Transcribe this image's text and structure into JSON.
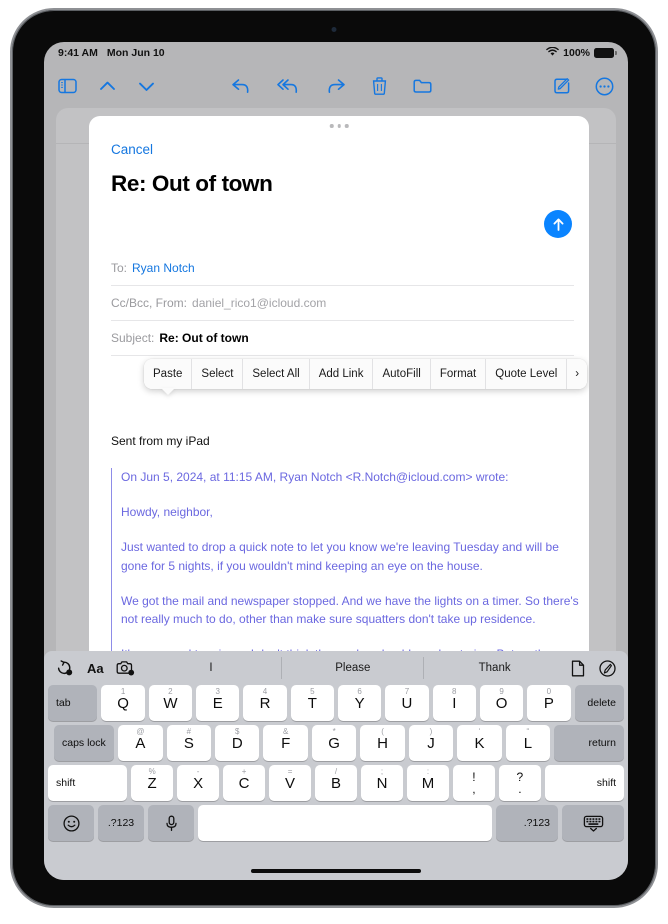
{
  "status_bar": {
    "time": "9:41 AM",
    "date": "Mon Jun 10",
    "battery_percent": "100%",
    "wifi_icon": "wifi-icon",
    "battery_icon": "battery-full-icon"
  },
  "mail_toolbar": {
    "sidebar_toggle": "sidebar-toggle-icon",
    "previous_message": "chevron-up-icon",
    "next_message": "chevron-down-icon",
    "reply": "reply-icon",
    "reply_all": "reply-all-icon",
    "forward": "forward-icon",
    "delete": "trash-icon",
    "move": "folder-icon",
    "compose": "compose-icon",
    "more": "ellipsis-circle-icon"
  },
  "compose": {
    "cancel_label": "Cancel",
    "title": "Re: Out of town",
    "send_icon": "arrow-up-circle-icon",
    "grabber": "sheet-grabber",
    "fields": {
      "to_label": "To:",
      "to_value": "Ryan Notch",
      "ccbcc_label": "Cc/Bcc, From:",
      "ccbcc_value": "daniel_rico1@icloud.com",
      "subject_label": "Subject:",
      "subject_value": "Re: Out of town"
    },
    "signature": "Sent from my iPad",
    "quote": [
      "On Jun 5, 2024, at 11:15 AM, Ryan Notch <R.Notch@icloud.com> wrote:",
      "Howdy, neighbor,",
      "Just wanted to drop a quick note to let you know we're leaving Tuesday and will be gone for 5 nights, if you wouldn't mind keeping an eye on the house.",
      "We got the mail and newspaper stopped. And we have the lights on a timer. So there's not really much to do, other than make sure squatters don't take up residence.",
      "It's supposed to rain, so I don't think the garden should need watering. But on the"
    ]
  },
  "edit_menu": {
    "items": [
      {
        "label": "Paste"
      },
      {
        "label": "Select"
      },
      {
        "label": "Select All"
      },
      {
        "label": "Add Link"
      },
      {
        "label": "AutoFill"
      },
      {
        "label": "Format"
      },
      {
        "label": "Quote Level"
      },
      {
        "label": "›"
      }
    ]
  },
  "keyboard": {
    "predictive": {
      "undo_icon": "undo-badge-icon",
      "text_format_label": "Aa",
      "camera_icon": "camera-badge-icon",
      "suggestions": [
        "I",
        "Please",
        "Thank"
      ],
      "document_icon": "document-icon",
      "markup_icon": "markup-pen-icon"
    },
    "rows": [
      {
        "keys": [
          {
            "label": "tab",
            "type": "dark",
            "width": "key-tab",
            "align": "left"
          },
          {
            "label": "Q",
            "sub": "1",
            "width": "key-letter"
          },
          {
            "label": "W",
            "sub": "2",
            "width": "key-letter"
          },
          {
            "label": "E",
            "sub": "3",
            "width": "key-letter"
          },
          {
            "label": "R",
            "sub": "4",
            "width": "key-letter"
          },
          {
            "label": "T",
            "sub": "5",
            "width": "key-letter"
          },
          {
            "label": "Y",
            "sub": "6",
            "width": "key-letter"
          },
          {
            "label": "U",
            "sub": "7",
            "width": "key-letter"
          },
          {
            "label": "I",
            "sub": "8",
            "width": "key-letter"
          },
          {
            "label": "O",
            "sub": "9",
            "width": "key-letter"
          },
          {
            "label": "P",
            "sub": "0",
            "width": "key-letter"
          },
          {
            "label": "delete",
            "type": "dark",
            "width": "key-delete",
            "align": "right"
          }
        ]
      },
      {
        "keys": [
          {
            "label": "caps lock",
            "type": "dark",
            "width": "key-caps",
            "align": "left"
          },
          {
            "label": "A",
            "sub": "@",
            "width": "key-letter"
          },
          {
            "label": "S",
            "sub": "#",
            "width": "key-letter"
          },
          {
            "label": "D",
            "sub": "$",
            "width": "key-letter"
          },
          {
            "label": "F",
            "sub": "&",
            "width": "key-letter"
          },
          {
            "label": "G",
            "sub": "*",
            "width": "key-letter"
          },
          {
            "label": "H",
            "sub": "(",
            "width": "key-letter"
          },
          {
            "label": "J",
            "sub": ")",
            "width": "key-letter"
          },
          {
            "label": "K",
            "sub": "‘",
            "width": "key-letter"
          },
          {
            "label": "L",
            "sub": "“",
            "width": "key-letter"
          },
          {
            "label": "return",
            "type": "dark",
            "width": "key-return",
            "align": "right"
          }
        ]
      },
      {
        "keys": [
          {
            "label": "shift",
            "width": "key-shift-l",
            "align": "left"
          },
          {
            "label": "Z",
            "sub": "%",
            "width": "key-letter"
          },
          {
            "label": "X",
            "sub": "-",
            "width": "key-letter"
          },
          {
            "label": "C",
            "sub": "+",
            "width": "key-letter"
          },
          {
            "label": "V",
            "sub": "=",
            "width": "key-letter"
          },
          {
            "label": "B",
            "sub": "/",
            "width": "key-letter"
          },
          {
            "label": "N",
            "sub": ";",
            "width": "key-letter"
          },
          {
            "label": "M",
            "sub": ":",
            "width": "key-letter"
          },
          {
            "label": ",",
            "top": "!",
            "width": "key-small",
            "dual": true
          },
          {
            "label": ".",
            "top": "?",
            "width": "key-small",
            "dual": true
          },
          {
            "label": "shift",
            "width": "key-shift-r",
            "align": "right"
          }
        ]
      },
      {
        "keys": [
          {
            "label": "emoji-icon",
            "type": "dark",
            "width": "key-small",
            "icon": "emoji"
          },
          {
            "label": ".?123",
            "type": "dark",
            "width": "key-small"
          },
          {
            "label": "dictation-icon",
            "type": "dark",
            "width": "key-small",
            "icon": "mic"
          },
          {
            "label": "",
            "width": "key-space"
          },
          {
            "label": ".?123",
            "type": "dark",
            "width": "key-caps",
            "align": "right"
          },
          {
            "label": "dismiss-keyboard-icon",
            "type": "dark",
            "width": "key-caps",
            "icon": "dismiss"
          }
        ]
      }
    ]
  },
  "colors": {
    "accent_blue": "#1577e0",
    "send_blue": "#0a84ff",
    "quote_purple": "#6b68e0",
    "keyboard_bg": "#c9cbd0",
    "key_dark": "#b0b3ba"
  }
}
